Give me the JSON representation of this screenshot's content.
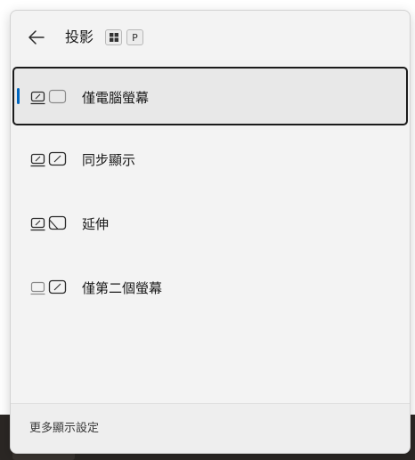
{
  "header": {
    "title": "投影",
    "shortcut_win_icon": "windows-logo-icon",
    "shortcut_key": "P",
    "back_icon": "back-arrow-icon"
  },
  "options": [
    {
      "label": "僅電腦螢幕",
      "icon": "pc-screen-only-icon",
      "selected": true
    },
    {
      "label": "同步顯示",
      "icon": "duplicate-icon",
      "selected": false
    },
    {
      "label": "延伸",
      "icon": "extend-icon",
      "selected": false
    },
    {
      "label": "僅第二個螢幕",
      "icon": "second-screen-only-icon",
      "selected": false
    }
  ],
  "footer": {
    "link_label": "更多顯示設定"
  },
  "colors": {
    "accent": "#0067c0",
    "panel_bg": "#f3f3f3",
    "selected_bg": "#e8e8e8",
    "selected_border": "#1b1b1b"
  }
}
